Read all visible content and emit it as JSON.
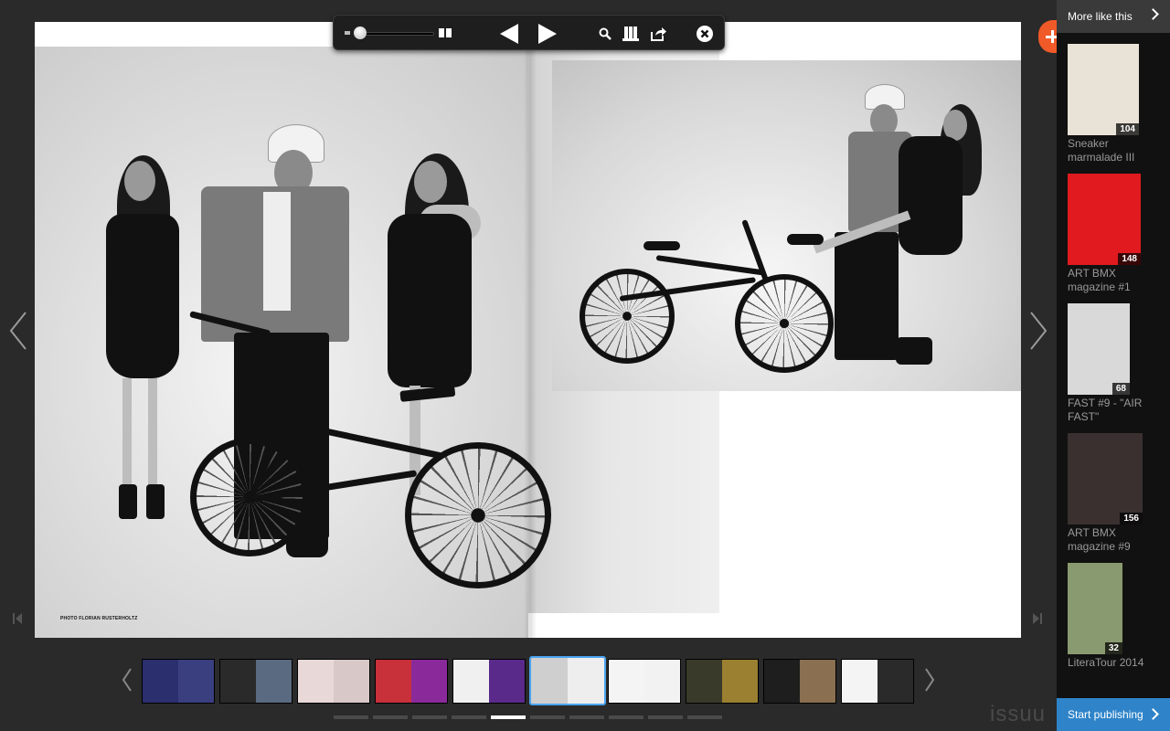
{
  "reader": {
    "photo_credit": "PHOTO FLORIAN RUSTERHOLTZ"
  },
  "toolbar": {
    "zoom_slider": "zoom-slider",
    "two_page_icon": "two-page-view-icon",
    "prev_icon": "previous-page-icon",
    "next_icon": "next-page-icon",
    "search_icon": "search-icon",
    "library_icon": "library-icon",
    "share_icon": "share-icon",
    "close_icon": "close-icon"
  },
  "sidebar": {
    "header_label": "More like this",
    "items": [
      {
        "title": "Sneaker marmalade III",
        "pages": "104",
        "cover_color": "#e9e2d6"
      },
      {
        "title": "ART BMX magazine #1",
        "pages": "148",
        "cover_color": "#e01a1f"
      },
      {
        "title": "FAST #9 - \"AIR FAST\"",
        "pages": "68",
        "cover_color": "#d9d9d9"
      },
      {
        "title": "ART BMX magazine #9",
        "pages": "156",
        "cover_color": "#3a3030"
      },
      {
        "title": "LiteraTour 2014",
        "pages": "32",
        "cover_color": "#8a9a70"
      }
    ],
    "start_publishing": "Start publishing"
  },
  "brand": {
    "logo_text": "issuu",
    "accent": "#2f84c9",
    "plus_color": "#ef5a28"
  },
  "thumbnails": {
    "active_index": 5,
    "items": [
      {
        "left": "#2b2f6e",
        "right": "#3a3f80"
      },
      {
        "left": "#2a2a2a",
        "right": "#5a6a80"
      },
      {
        "left": "#e8d8d8",
        "right": "#d8c8c8"
      },
      {
        "left": "#c8303a",
        "right": "#8a2a9a"
      },
      {
        "left": "#f0f0f0",
        "right": "#5a2a8a"
      },
      {
        "left": "#cfcfcf",
        "right": "#eeeeee"
      },
      {
        "left": "#f4f4f4",
        "right": "#f2f2f2"
      },
      {
        "left": "#3a3a2a",
        "right": "#9a8030"
      },
      {
        "left": "#1e1e1e",
        "right": "#8a7050"
      },
      {
        "left": "#f4f4f4",
        "right": "#2a2a2a"
      }
    ],
    "page_dots": 10,
    "active_dot": 4
  }
}
